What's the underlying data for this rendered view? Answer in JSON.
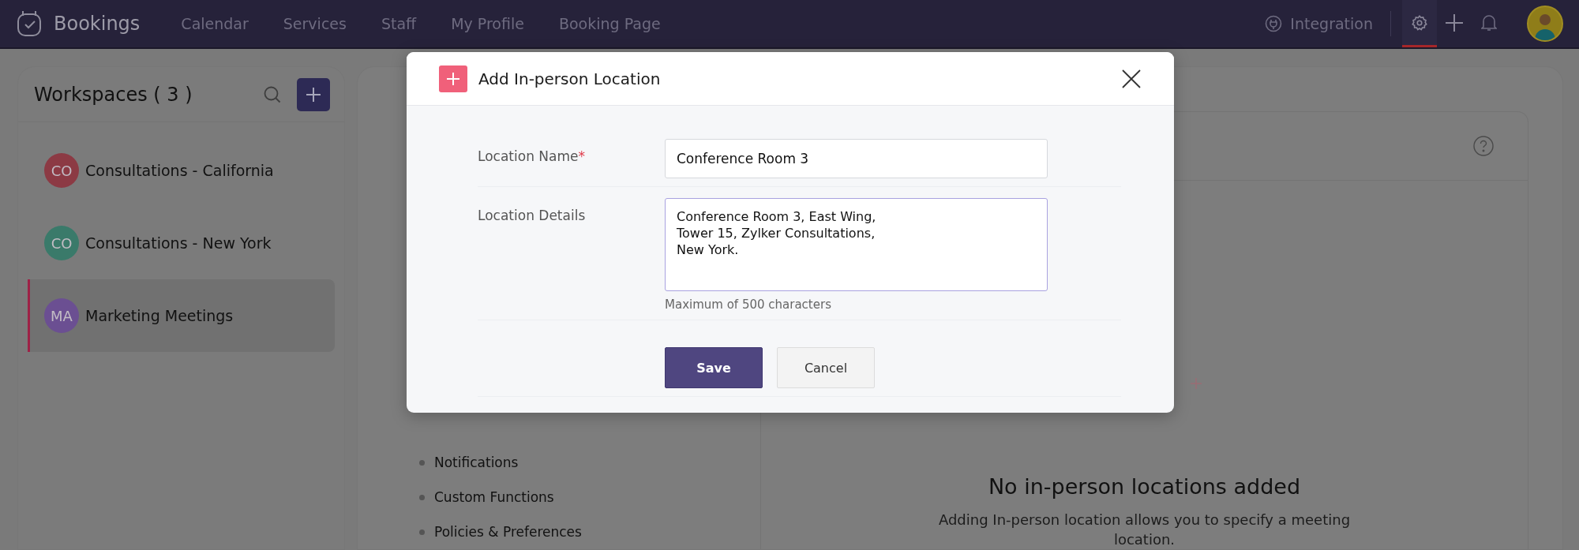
{
  "top_nav": {
    "brand": "Bookings",
    "items": [
      {
        "label": "Calendar",
        "selected": false
      },
      {
        "label": "Services",
        "selected": false
      },
      {
        "label": "Staff",
        "selected": false
      },
      {
        "label": "My Profile",
        "selected": false
      },
      {
        "label": "Booking Page",
        "selected": false
      }
    ],
    "integration": "Integration",
    "tools": [
      {
        "kind": "settings",
        "selected": true
      },
      {
        "kind": "add",
        "selected": false
      },
      {
        "kind": "notifications",
        "selected": false
      }
    ]
  },
  "sidebar": {
    "title": "Workspaces ( 3 )",
    "items": [
      {
        "initials": "CO",
        "name": "Consultations - California",
        "color": "#8c3a44",
        "selected": false
      },
      {
        "initials": "CO",
        "name": "Consultations - New York",
        "color": "#3a7a6a",
        "selected": false
      },
      {
        "initials": "MA",
        "name": "Marketing Meetings",
        "color": "#6b4f92",
        "selected": true
      }
    ]
  },
  "settings_menu": [
    "Notifications",
    "Custom Functions",
    "Policies & Preferences"
  ],
  "empty_state": {
    "title": "No in-person locations added",
    "description": "Adding In-person location allows you to specify a meeting location."
  },
  "modal": {
    "title": "Add In-person Location",
    "fields": [
      {
        "kind": "input",
        "label": "Location Name",
        "required_mark": "*",
        "value": "Conference Room 3",
        "focused": false
      },
      {
        "kind": "textarea",
        "label": "Location Details",
        "value": "Conference Room 3, East Wing,\nTower 15, Zylker Consultations,\nNew York.",
        "hint": "Maximum of 500 characters",
        "focused": true
      }
    ],
    "buttons": [
      {
        "kind": "primary",
        "label": "Save"
      },
      {
        "kind": "secondary",
        "label": "Cancel"
      }
    ]
  }
}
